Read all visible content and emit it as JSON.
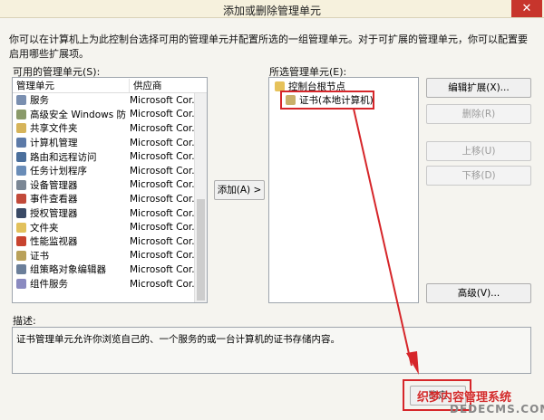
{
  "window": {
    "title": "添加或删除管理单元",
    "close_glyph": "✕"
  },
  "intro": "你可以在计算机上为此控制台选择可用的管理单元并配置所选的一组管理单元。对于可扩展的管理单元，你可以配置要启用哪些扩展项。",
  "available": {
    "label": "可用的管理单元(S):",
    "col_name": "管理单元",
    "col_vendor": "供应商",
    "items": [
      {
        "name": "服务",
        "vendor": "Microsoft Cor...",
        "icon_color": "#7a8fb0"
      },
      {
        "name": "高级安全 Windows 防...",
        "vendor": "Microsoft Cor...",
        "icon_color": "#8a9a6a"
      },
      {
        "name": "共享文件夹",
        "vendor": "Microsoft Cor...",
        "icon_color": "#d6b45a"
      },
      {
        "name": "计算机管理",
        "vendor": "Microsoft Cor...",
        "icon_color": "#5c7aa8"
      },
      {
        "name": "路由和远程访问",
        "vendor": "Microsoft Cor...",
        "icon_color": "#4b6f9c"
      },
      {
        "name": "任务计划程序",
        "vendor": "Microsoft Cor...",
        "icon_color": "#6a8db8"
      },
      {
        "name": "设备管理器",
        "vendor": "Microsoft Cor...",
        "icon_color": "#7b8795"
      },
      {
        "name": "事件查看器",
        "vendor": "Microsoft Cor...",
        "icon_color": "#c24a3a"
      },
      {
        "name": "授权管理器",
        "vendor": "Microsoft Cor...",
        "icon_color": "#3a4a66"
      },
      {
        "name": "文件夹",
        "vendor": "Microsoft Cor...",
        "icon_color": "#e2c15c"
      },
      {
        "name": "性能监视器",
        "vendor": "Microsoft Cor...",
        "icon_color": "#c8432f"
      },
      {
        "name": "证书",
        "vendor": "Microsoft Cor...",
        "icon_color": "#b9a15a"
      },
      {
        "name": "组策略对象编辑器",
        "vendor": "Microsoft Cor...",
        "icon_color": "#6b7f9a"
      },
      {
        "name": "组件服务",
        "vendor": "Microsoft Cor...",
        "icon_color": "#8a8ac0"
      }
    ]
  },
  "add_button": "添加(A) >",
  "selected": {
    "label": "所选管理单元(E):",
    "root": "控制台根节点",
    "child": "证书(本地计算机)"
  },
  "buttons": {
    "edit_ext": "编辑扩展(X)...",
    "remove": "删除(R)",
    "move_up": "上移(U)",
    "move_down": "下移(D)",
    "advanced": "高级(V)...",
    "ok": "确定"
  },
  "description": {
    "label": "描述:",
    "text": "证书管理单元允许你浏览自己的、一个服务的或一台计算机的证书存储内容。"
  },
  "watermark": {
    "line1": "织梦内容管理系统",
    "line2": "DEDECMS.COM"
  },
  "highlight_color": "#d6262a"
}
